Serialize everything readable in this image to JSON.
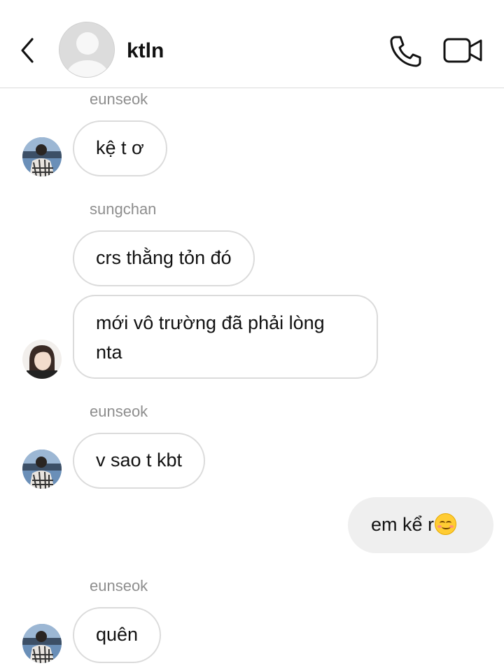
{
  "header": {
    "contact_name": "ktln"
  },
  "messages": [
    {
      "sender": "eunseok",
      "text": "kệ t ơ"
    },
    {
      "sender": "sungchan",
      "text": "crs thằng tỏn đó"
    },
    {
      "sender": "sungchan",
      "text": "mới vô trường đã phải lòng nta"
    },
    {
      "sender": "eunseok",
      "text": "v sao t kbt"
    },
    {
      "sender": "me",
      "text": "em kể r",
      "emoji": "relieved-face-emoji"
    },
    {
      "sender": "eunseok",
      "text": "quên"
    }
  ],
  "sender_labels": {
    "s1": "eunseok",
    "s2": "sungchan",
    "s3": "eunseok",
    "s4": "eunseok"
  },
  "colors": {
    "bubble_border": "#dbdbdb",
    "my_bubble_bg": "#efefef",
    "sender_label": "#8e8e8e",
    "divider": "#dcdcdc"
  }
}
